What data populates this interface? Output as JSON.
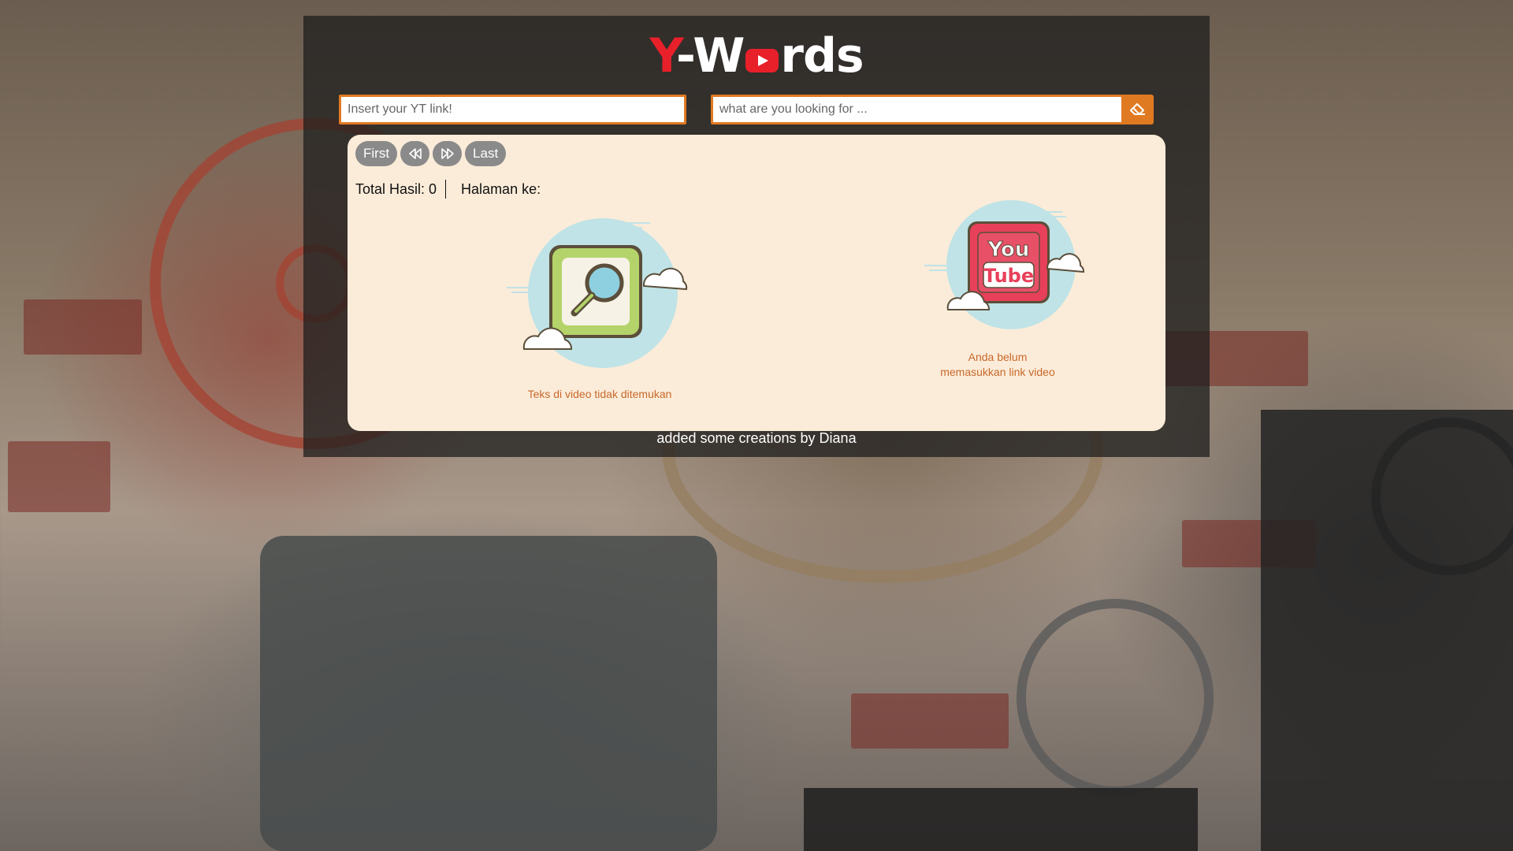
{
  "app": {
    "logo": {
      "part1": "Y",
      "part2": "-W",
      "part3": "rds"
    }
  },
  "inputs": {
    "yt_link_placeholder": "Insert your YT link!",
    "yt_link_value": "",
    "search_placeholder": "what are you looking for ...",
    "search_value": ""
  },
  "pagination": {
    "first_label": "First",
    "prev_icon": "rewind-icon",
    "next_icon": "fast-forward-icon",
    "last_label": "Last"
  },
  "stats": {
    "total_label": "Total Hasil: 0",
    "page_label": "Halaman ke:"
  },
  "illustrations": {
    "search": {
      "icon": "magnifier-board-icon",
      "caption": "Teks di video tidak ditemukan"
    },
    "youtube": {
      "icon": "youtube-logo-icon",
      "caption_line1": "Anda belum",
      "caption_line2": "memasukkan link video"
    }
  },
  "footer": {
    "text": "added some creations by Diana"
  },
  "colors": {
    "accent_orange": "#e07a22",
    "logo_red": "#e8202a",
    "card_bg": "#fbecd9",
    "pager_gray": "#8a8a8a",
    "caption_orange": "#c8682a"
  },
  "clear_button_icon": "eraser-icon"
}
